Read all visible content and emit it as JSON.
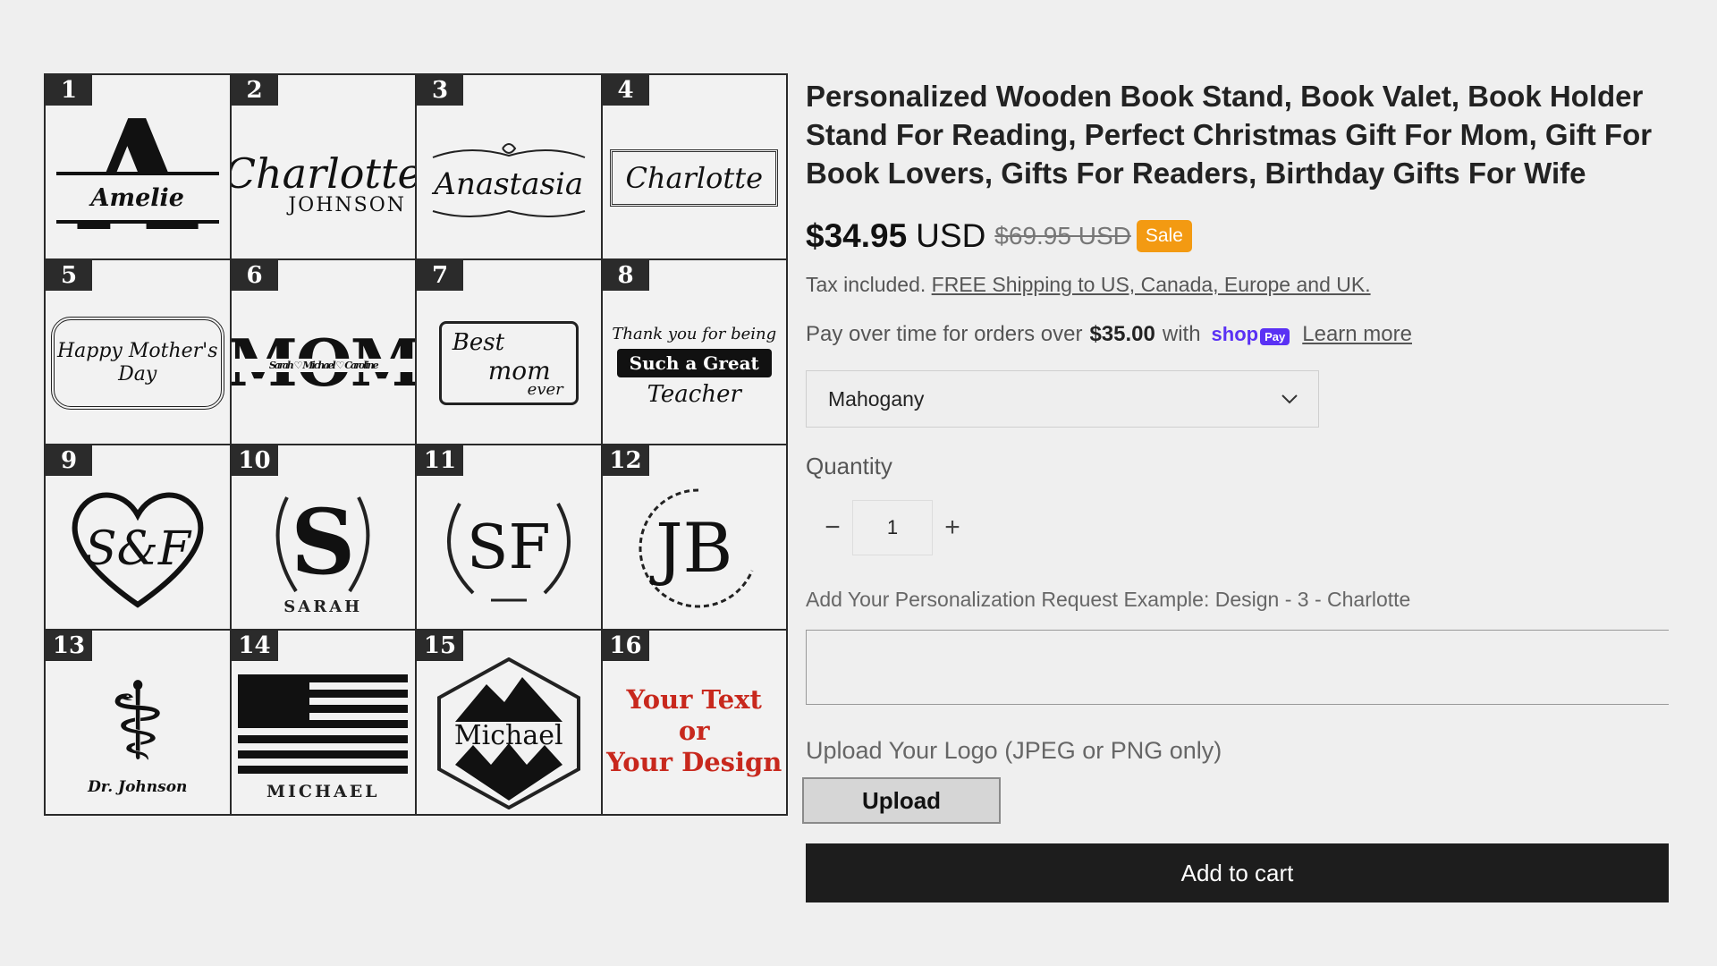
{
  "designs": [
    {
      "num": "1",
      "text": "A",
      "sub": "Amelie"
    },
    {
      "num": "2",
      "text": "Charlotte",
      "sub": "JOHNSON"
    },
    {
      "num": "3",
      "text": "Anastasia"
    },
    {
      "num": "4",
      "text": "Charlotte"
    },
    {
      "num": "5",
      "text": "Happy Mother's Day"
    },
    {
      "num": "6",
      "text": "MOM",
      "sub": "Sarah ♡ Michael ♡ Caroline"
    },
    {
      "num": "7",
      "a": "Best",
      "b": "mom",
      "c": "ever"
    },
    {
      "num": "8",
      "a": "Thank you for being",
      "b": "Such a Great",
      "c": "Teacher"
    },
    {
      "num": "9",
      "text": "S&F"
    },
    {
      "num": "10",
      "text": "S",
      "sub": "SARAH"
    },
    {
      "num": "11",
      "text": "SF"
    },
    {
      "num": "12",
      "text": "JB"
    },
    {
      "num": "13",
      "sub": "Dr. Johnson"
    },
    {
      "num": "14",
      "sub": "MICHAEL"
    },
    {
      "num": "15",
      "text": "Michael"
    },
    {
      "num": "16",
      "a": "Your Text",
      "b": "or",
      "c": "Your Design"
    }
  ],
  "product": {
    "title": "Personalized Wooden Book Stand, Book Valet, Book Holder Stand For Reading, Perfect Christmas Gift For Mom, Gift For Book Lovers, Gifts For Readers, Birthday Gifts For Wife",
    "price": "$34.95",
    "currency": "USD",
    "compare_price": "$69.95 USD",
    "sale_badge": "Sale",
    "tax_text": "Tax included.",
    "shipping_link": "FREE Shipping to US, Canada, Europe and UK.",
    "pay_text": "Pay over time for orders over",
    "pay_amount": "$35.00",
    "pay_with": "with",
    "shop_brand": "shop",
    "pay_brand": "Pay",
    "learn_more": "Learn more",
    "variant_selected": "Mahogany",
    "quantity_label": "Quantity",
    "quantity_value": "1",
    "minus": "−",
    "plus": "+",
    "personalization_label": "Add Your Personalization Request Example: Design - 3 - Charlotte",
    "upload_label": "Upload Your Logo (JPEG or PNG only)",
    "upload_button": "Upload",
    "add_to_cart": "Add to cart"
  },
  "colors": {
    "background": "#efefef",
    "sale_badge": "#f39a12",
    "shop_pay": "#5a31f4",
    "cart_button": "#1d1d1d",
    "design_16_text": "#c8281d"
  },
  "icons": [
    "chevron-down-icon",
    "minus-icon",
    "plus-icon",
    "caduceus-icon",
    "us-flag-icon",
    "mountain-icon",
    "heart-icon",
    "laurel-wreath-icon"
  ]
}
